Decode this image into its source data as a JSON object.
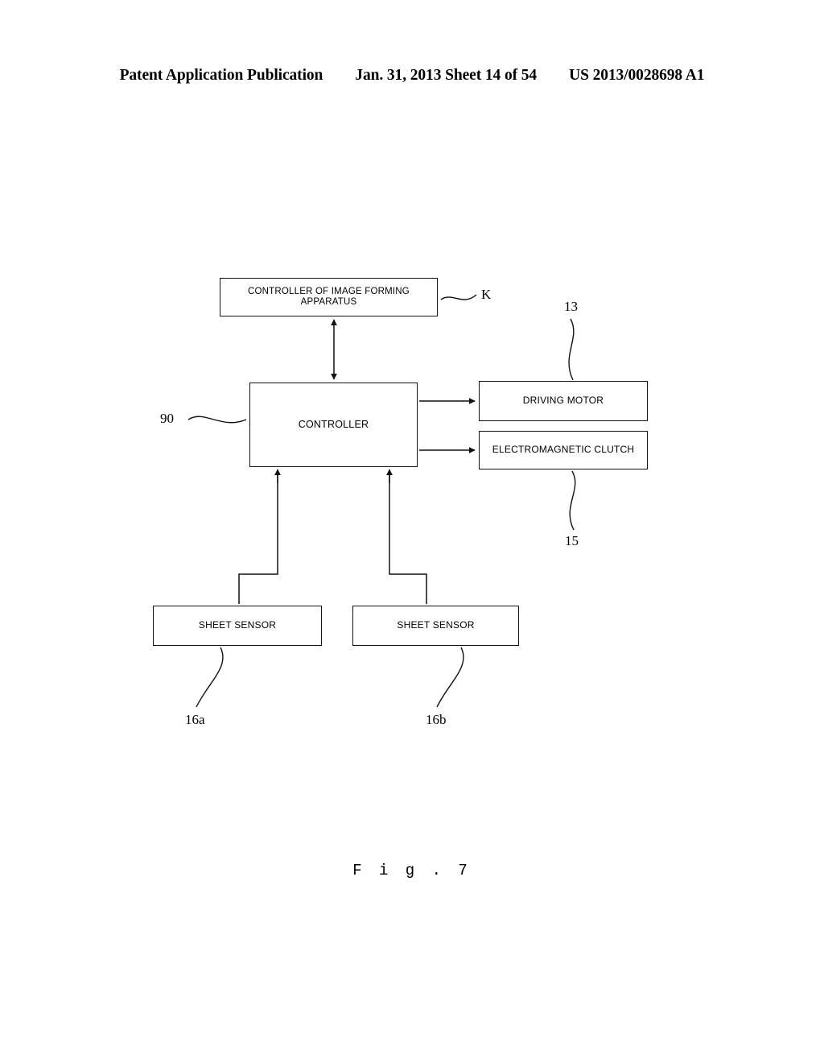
{
  "header": {
    "publication": "Patent Application Publication",
    "date_sheet": "Jan. 31, 2013  Sheet 14 of 54",
    "doc_number": "US 2013/0028698 A1"
  },
  "figure": {
    "caption": "F i g .  7",
    "blocks": [
      {
        "id": "top_controller",
        "label": "CONTROLLER OF IMAGE FORMING APPARATUS",
        "ref": "K"
      },
      {
        "id": "controller",
        "label": "CONTROLLER",
        "ref": "90"
      },
      {
        "id": "driving_motor",
        "label": "DRIVING MOTOR",
        "ref": "13"
      },
      {
        "id": "electromagnetic_clutch",
        "label": "ELECTROMAGNETIC CLUTCH",
        "ref": "15"
      },
      {
        "id": "sheet_sensor_a",
        "label": "SHEET SENSOR",
        "ref": "16a"
      },
      {
        "id": "sheet_sensor_b",
        "label": "SHEET SENSOR",
        "ref": "16b"
      }
    ],
    "refs": {
      "k": "K",
      "n13": "13",
      "n90": "90",
      "n15": "15",
      "n16a": "16a",
      "n16b": "16b"
    },
    "connections": [
      {
        "from": "controller",
        "to": "top_controller",
        "arrow": "double"
      },
      {
        "from": "controller",
        "to": "driving_motor",
        "arrow": "single"
      },
      {
        "from": "controller",
        "to": "electromagnetic_clutch",
        "arrow": "single"
      },
      {
        "from": "sheet_sensor_a",
        "to": "controller",
        "arrow": "single"
      },
      {
        "from": "sheet_sensor_b",
        "to": "controller",
        "arrow": "single"
      }
    ]
  },
  "colors": {
    "ink": "#111111",
    "page": "#ffffff"
  }
}
